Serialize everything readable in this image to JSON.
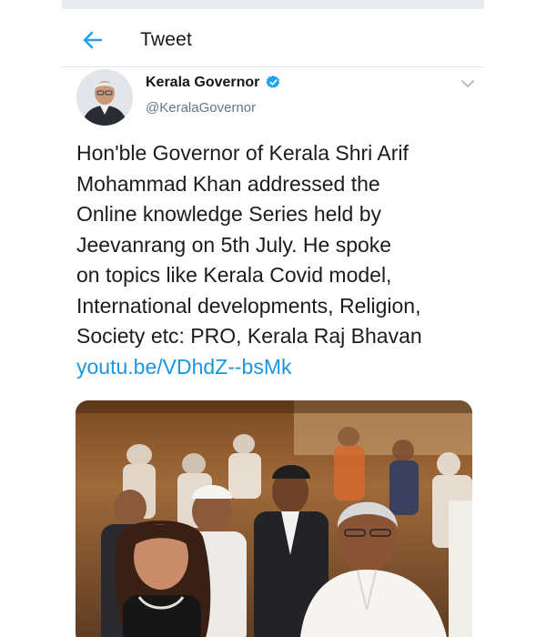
{
  "header": {
    "title": "Tweet",
    "back_icon": "arrow-left-icon"
  },
  "author": {
    "name": "Kerala Governor",
    "handle": "@KeralaGovernor",
    "verified_icon": "verified-badge-icon",
    "menu_icon": "chevron-down-icon"
  },
  "tweet": {
    "lines": [
      "Hon'ble Governor of Kerala Shri Arif",
      "Mohammad Khan addressed the",
      "Online knowledge Series held by",
      "Jeevanrang on 5th July. He spoke",
      "on topics like Kerala Covid model,",
      "International developments, Religion,",
      "Society etc: PRO, Kerala Raj Bhavan"
    ],
    "link": "youtu.be/VDhdZ--bsMk"
  },
  "colors": {
    "accent": "#1da1f2",
    "link": "#1b95e0",
    "secondary_text": "#657786"
  }
}
